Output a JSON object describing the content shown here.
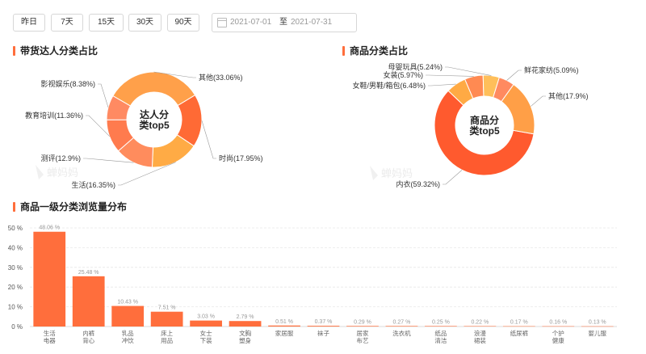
{
  "filters": {
    "buttons": [
      "昨日",
      "7天",
      "15天",
      "30天",
      "90天"
    ],
    "date_start": "2021-07-01",
    "date_sep": "至",
    "date_end": "2021-07-31"
  },
  "watermark": "蝉妈妈",
  "colors": {
    "accent": "#ff6e3c",
    "bar": "#ff6e3c",
    "grid": "#e8e8e8",
    "pie1": [
      "#ff6a35",
      "#ffab45",
      "#ff8c5d",
      "#ff7b4e",
      "#ff8a62",
      "#ffa04a"
    ],
    "pie2": [
      "#ff5a2e",
      "#ffaa44",
      "#ff8a52",
      "#ffbf5a",
      "#ff8a60",
      "#ff9f47"
    ]
  },
  "chart_data": [
    {
      "type": "pie",
      "title": "带货达人分类占比",
      "center_label": [
        "达人分",
        "类top5"
      ],
      "slices": [
        {
          "label": "时尚(17.95%)",
          "value": 17.95
        },
        {
          "label": "生活(16.35%)",
          "value": 16.35
        },
        {
          "label": "测评(12.9%)",
          "value": 12.9
        },
        {
          "label": "教育培训(11.36%)",
          "value": 11.36
        },
        {
          "label": "影视娱乐(8.38%)",
          "value": 8.38
        },
        {
          "label": "其他(33.06%)",
          "value": 33.06
        }
      ]
    },
    {
      "type": "pie",
      "title": "商品分类占比",
      "center_label": [
        "商品分",
        "类top5"
      ],
      "slices": [
        {
          "label": "内衣(59.32%)",
          "value": 59.32
        },
        {
          "label": "女鞋/男鞋/箱包(6.48%)",
          "value": 6.48
        },
        {
          "label": "女装(5.97%)",
          "value": 5.97
        },
        {
          "label": "母婴玩具(5.24%)",
          "value": 5.24
        },
        {
          "label": "鲜花家纺(5.09%)",
          "value": 5.09
        },
        {
          "label": "其他(17.9%)",
          "value": 17.9
        }
      ]
    },
    {
      "type": "bar",
      "title": "商品一级分类浏览量分布",
      "ylim": [
        0,
        50
      ],
      "yticks": [
        "0 %",
        "10 %",
        "20 %",
        "30 %",
        "40 %",
        "50 %"
      ],
      "categories": [
        "生活电器",
        "内裤背心",
        "乳品冲饮",
        "床上用品",
        "女士下装",
        "文胸塑身",
        "家居服",
        "袜子",
        "居家布艺",
        "洗衣机",
        "纸品清洁",
        "浪漫裙装",
        "纸尿裤",
        "个护健康",
        "婴儿服"
      ],
      "values": [
        48.06,
        25.48,
        10.43,
        7.51,
        3.03,
        2.79,
        0.51,
        0.37,
        0.29,
        0.27,
        0.25,
        0.22,
        0.17,
        0.16,
        0.13
      ],
      "labels": [
        "48.06 %",
        "25.48 %",
        "10.43 %",
        "7.51 %",
        "3.03 %",
        "2.79 %",
        "0.51 %",
        "0.37 %",
        "0.29 %",
        "0.27 %",
        "0.25 %",
        "0.22 %",
        "0.17 %",
        "0.16 %",
        "0.13 %"
      ]
    }
  ]
}
